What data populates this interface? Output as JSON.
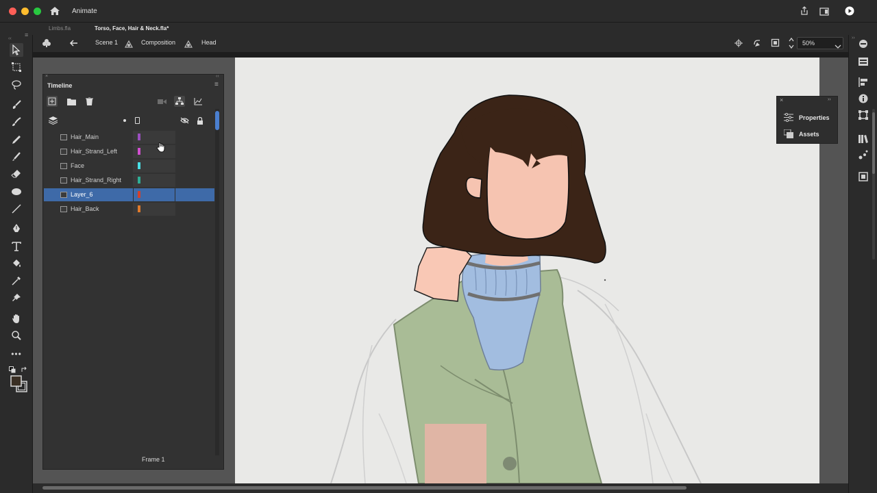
{
  "app": {
    "title": "Animate"
  },
  "tabs": [
    {
      "label": "Limbs.fla"
    },
    {
      "label": "Torso, Face, Hair & Neck.fla*"
    }
  ],
  "edit_bar": {
    "breadcrumb": [
      "Scene 1",
      "Composition",
      "Head"
    ],
    "zoom": "50%"
  },
  "timeline": {
    "title": "Timeline",
    "frame_label": "Frame 1",
    "layers": [
      {
        "name": "Hair_Main",
        "color": "#9b4fc0",
        "selected": false
      },
      {
        "name": "Hair_Strand_Left",
        "color": "#d14fd0",
        "selected": false
      },
      {
        "name": "Face",
        "color": "#49e0e6",
        "selected": false
      },
      {
        "name": "Hair_Strand_Right",
        "color": "#2fae95",
        "selected": false
      },
      {
        "name": "Layer_6",
        "color": "#d2412c",
        "selected": true
      },
      {
        "name": "Hair_Back",
        "color": "#e07a2c",
        "selected": false
      }
    ]
  },
  "panels": {
    "properties_label": "Properties",
    "assets_label": "Assets"
  },
  "colors": {
    "accent": "#3e6aa8",
    "chrome": "#2b2b2b",
    "stage": "#e9e9e7"
  }
}
